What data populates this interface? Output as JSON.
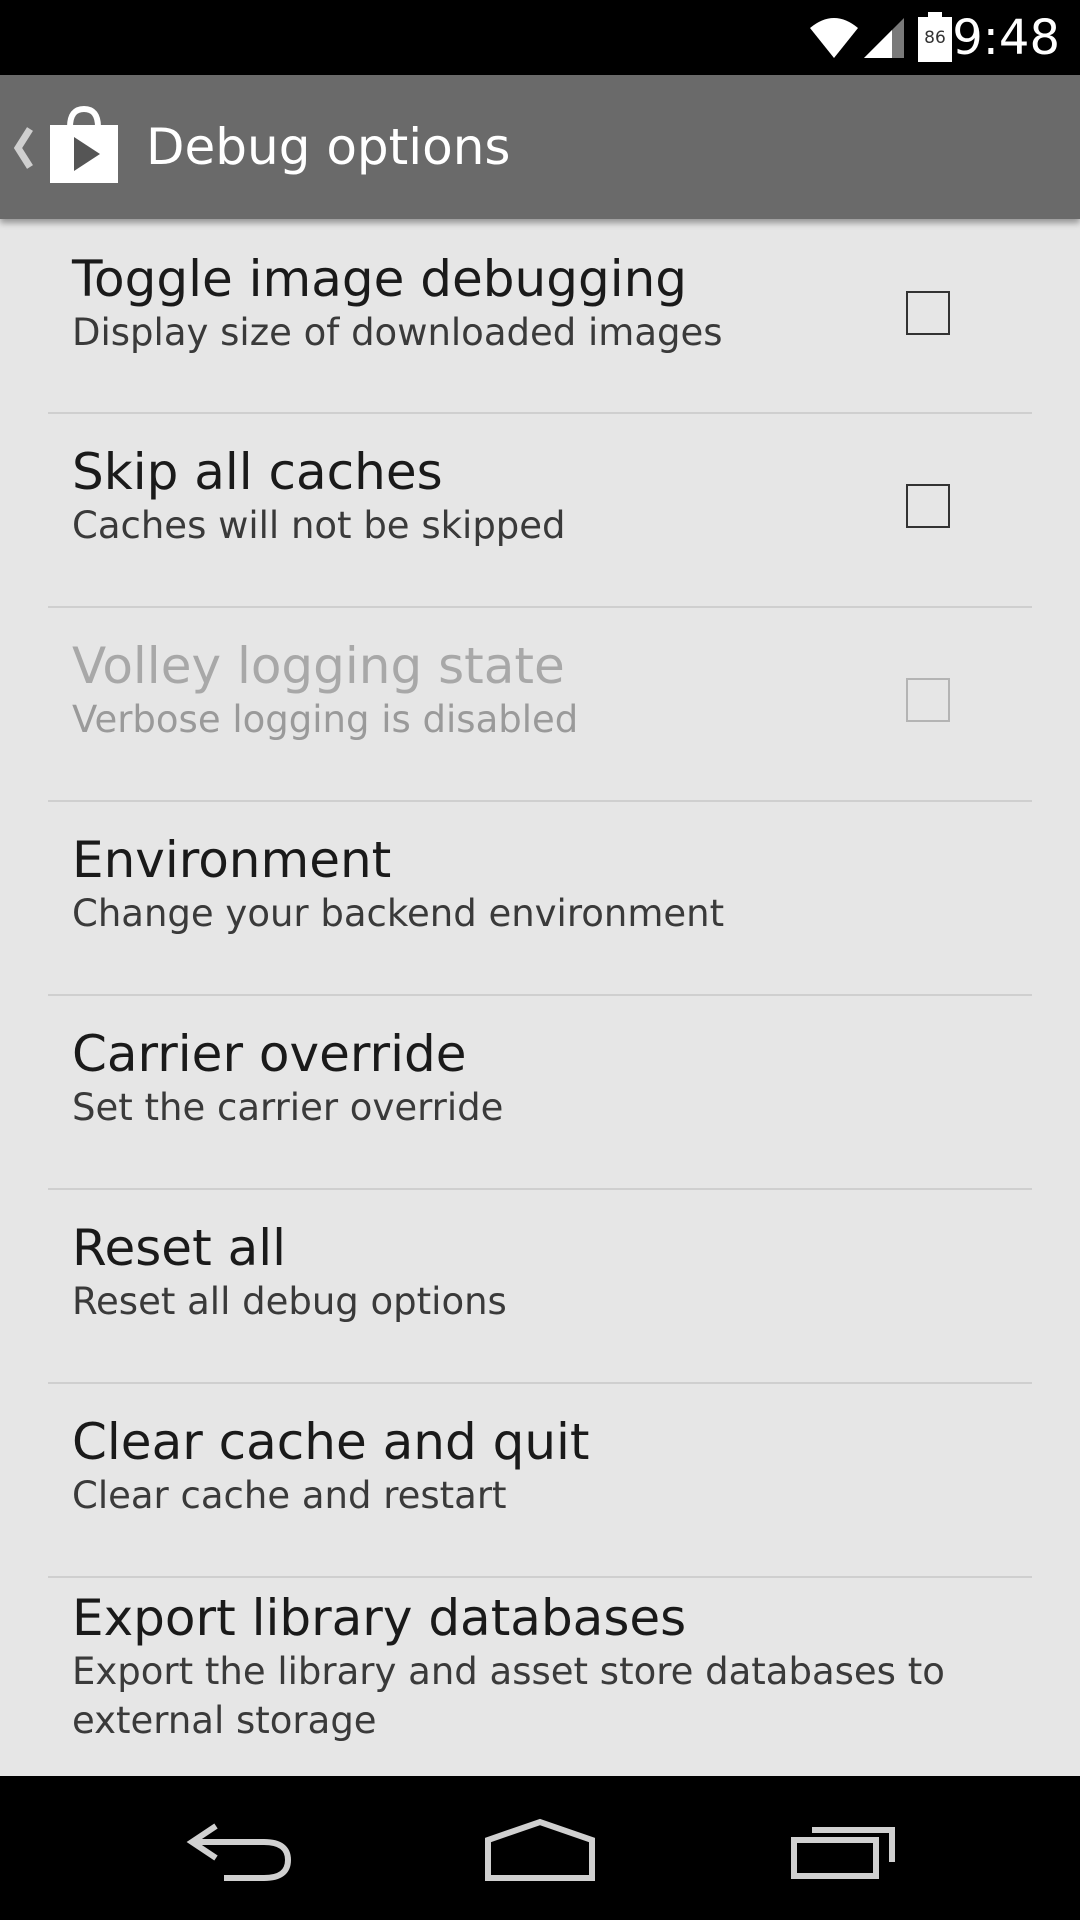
{
  "status_bar": {
    "time": "9:48",
    "battery_level": "86",
    "icons": [
      "wifi-icon",
      "cell-signal-icon",
      "battery-icon"
    ]
  },
  "action_bar": {
    "title": "Debug options",
    "icon": "play-store-bag-icon",
    "up_icon": "up-caret-icon"
  },
  "preferences": [
    {
      "title": "Toggle image debugging",
      "summary": "Display size of downloaded images",
      "has_checkbox": true,
      "checked": false,
      "enabled": true
    },
    {
      "title": "Skip all caches",
      "summary": "Caches will not be skipped",
      "has_checkbox": true,
      "checked": false,
      "enabled": true
    },
    {
      "title": "Volley logging state",
      "summary": "Verbose logging is disabled",
      "has_checkbox": true,
      "checked": false,
      "enabled": false
    },
    {
      "title": "Environment",
      "summary": "Change your backend environment",
      "has_checkbox": false,
      "enabled": true
    },
    {
      "title": "Carrier override",
      "summary": "Set the carrier override",
      "has_checkbox": false,
      "enabled": true
    },
    {
      "title": "Reset all",
      "summary": "Reset all debug options",
      "has_checkbox": false,
      "enabled": true
    },
    {
      "title": "Clear cache and quit",
      "summary": "Clear cache and restart",
      "has_checkbox": false,
      "enabled": true
    },
    {
      "title": "Export library databases",
      "summary": "Export the library and asset store databases to external storage",
      "has_checkbox": false,
      "enabled": true
    }
  ],
  "nav_bar": {
    "icons": [
      "back-icon",
      "home-icon",
      "recents-icon"
    ]
  },
  "colors": {
    "action_bar": "#6a6a6a",
    "background": "#e6e6e6",
    "system_bars": "#000000"
  }
}
